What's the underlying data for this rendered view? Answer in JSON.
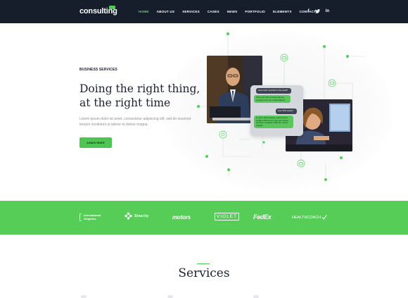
{
  "nav": {
    "logo": "consulting",
    "items": [
      {
        "label": "HOME",
        "active": true
      },
      {
        "label": "ABOUT US",
        "active": false
      },
      {
        "label": "SERVICES",
        "active": false
      },
      {
        "label": "CASES",
        "active": false
      },
      {
        "label": "NEWS",
        "active": false
      },
      {
        "label": "PORTFOLIO",
        "active": false
      },
      {
        "label": "ELEMENTS",
        "active": false
      },
      {
        "label": "CONTACTS",
        "active": false
      }
    ],
    "social": [
      "f",
      "t",
      "in"
    ]
  },
  "hero": {
    "eyebrow": "BUSINESS SERVICES",
    "headline_line1": "Doing the right thing,",
    "headline_line2": "at the right time",
    "lead": "Lorem ipsum dolor sit amet, consectetur adipiscing elit, sed do eiusmod tempor incididunt ut labore et dolore magna.",
    "cta": "Learn more",
    "chat": {
      "msg1": "How much countries in the world?",
      "msg2": "There are 195 countries that are recognized by the United Nations.",
      "msg3": "How VPN works?",
      "msg4": "To get a VPN working, you'll need to install a VPN server onto your device and then configure it with the correct settings."
    }
  },
  "logos": [
    "International Graphics",
    "Smartly",
    "motors",
    "VIOLET",
    "FedEx",
    "HEALTHCOACH"
  ],
  "services": {
    "title": "Services"
  },
  "colors": {
    "accent": "#55cd57",
    "nav_bg": "#161d2b",
    "text": "#1d2230"
  }
}
